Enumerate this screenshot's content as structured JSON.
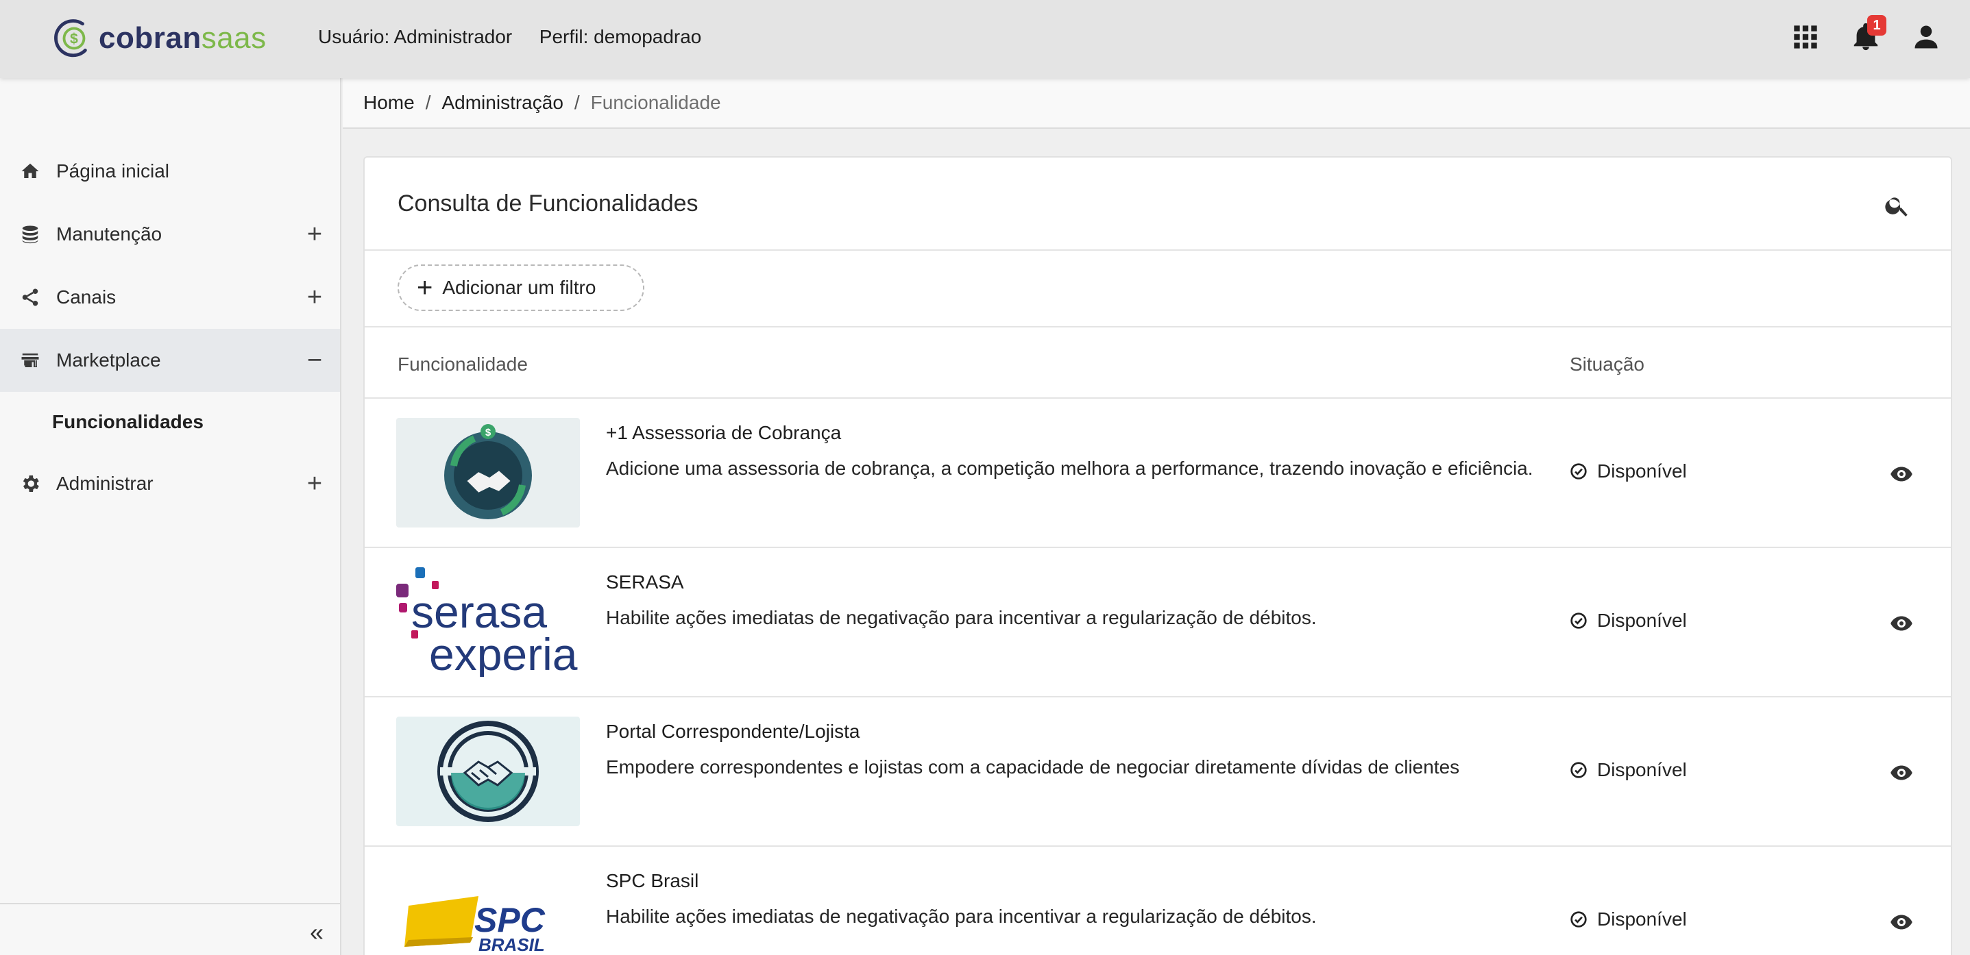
{
  "app": {
    "logo_part1": "cobran",
    "logo_part2": "saas",
    "brand_colors": {
      "primary": "#2c3361",
      "accent": "#7db84a"
    }
  },
  "header": {
    "user_label": "Usuário:",
    "user_value": "Administrador",
    "profile_label": "Perfil:",
    "profile_value": "demopadrao",
    "icons": [
      "apps-grid-icon",
      "notifications-icon",
      "account-icon"
    ],
    "notification_count": "1"
  },
  "sidebar": {
    "items": [
      {
        "label": "Página inicial",
        "icon": "home-icon",
        "toggle": ""
      },
      {
        "label": "Manutenção",
        "icon": "database-icon",
        "toggle": "+"
      },
      {
        "label": "Canais",
        "icon": "share-icon",
        "toggle": "+"
      },
      {
        "label": "Marketplace",
        "icon": "store-icon",
        "toggle": "−"
      },
      {
        "label": "Administrar",
        "icon": "gear-icon",
        "toggle": "+"
      }
    ],
    "subitems": [
      {
        "label": "Funcionalidades"
      }
    ],
    "collapse_label": "«"
  },
  "breadcrumb": {
    "items": [
      "Home",
      "Administração",
      "Funcionalidade"
    ],
    "separator": "/"
  },
  "page": {
    "title": "Consulta de Funcionalidades",
    "filter_button": "Adicionar um filtro",
    "filter_plus": "+",
    "columns": {
      "functionality": "Funcionalidade",
      "status": "Situação"
    }
  },
  "rows": [
    {
      "title": "+1 Assessoria de Cobrança",
      "description": "Adicione uma assessoria de cobrança, a competição melhora a performance, trazendo inovação e eficiência.",
      "status": "Disponível",
      "image": "handshake-collection-logo"
    },
    {
      "title": "SERASA",
      "description": "Habilite ações imediatas de negativação para incentivar a regularização de débitos.",
      "status": "Disponível",
      "image": "serasa-experian-logo",
      "logo_text_1": "serasa",
      "logo_text_2": "experian."
    },
    {
      "title": "Portal Correspondente/Lojista",
      "description": "Empodere correspondentes e lojistas com a capacidade de negociar diretamente dívidas de clientes",
      "status": "Disponível",
      "image": "handshake-portal-logo"
    },
    {
      "title": "SPC Brasil",
      "description": "Habilite ações imediatas de negativação para incentivar a regularização de débitos.",
      "status": "Disponível",
      "image": "spc-brasil-logo",
      "logo_text_1": "SPC",
      "logo_text_2": "BRASIL"
    }
  ]
}
